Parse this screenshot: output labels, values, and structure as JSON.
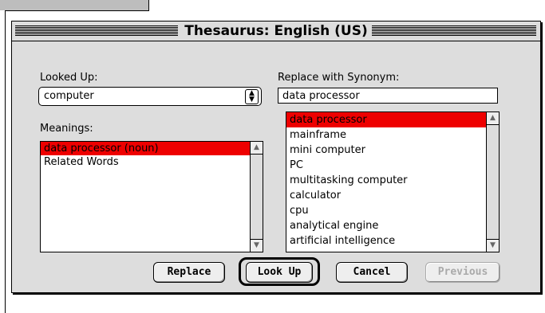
{
  "dialog": {
    "title": "Thesaurus: English (US)"
  },
  "looked_up": {
    "label": "Looked Up:",
    "value": "computer"
  },
  "meanings": {
    "label": "Meanings:",
    "items": [
      "data processor (noun)",
      "Related Words"
    ],
    "selected_index": 0
  },
  "synonym": {
    "label": "Replace with Synonym:",
    "value": "data processor",
    "items": [
      "data processor",
      "mainframe",
      "mini computer",
      "PC",
      "multitasking computer",
      "calculator",
      "cpu",
      "analytical engine",
      "artificial intelligence"
    ],
    "selected_index": 0
  },
  "buttons": {
    "replace": "Replace",
    "look_up": "Look Up",
    "cancel": "Cancel",
    "previous": "Previous"
  },
  "colors": {
    "selection": "#ee0000",
    "window": "#dddddd"
  },
  "icons": {
    "popup": "up-down-arrows-icon",
    "scroll_up": "scroll-up-arrow-icon",
    "scroll_down": "scroll-down-arrow-icon"
  }
}
